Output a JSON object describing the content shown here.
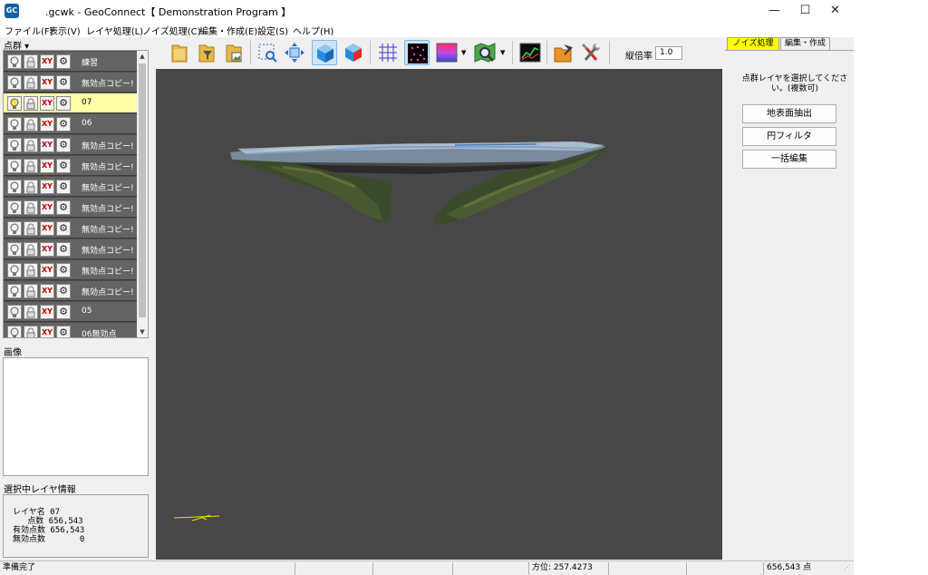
{
  "window": {
    "title": ".gcwk - GeoConnect【 Demonstration Program 】",
    "app_icon_text": "GC",
    "minimize": "—",
    "maximize": "☐",
    "close": "✕"
  },
  "menu": [
    "ファイル(F)",
    "表示(V)",
    "レイヤ処理(L)",
    "ノイズ処理(C)",
    "編集・作成(E)",
    "設定(S)",
    "ヘルプ(H)"
  ],
  "point_cloud_panel": {
    "label": "点群 ▾",
    "layers": [
      {
        "name": "練習",
        "selected": false
      },
      {
        "name": "無効点コピー!",
        "selected": false
      },
      {
        "name": "07",
        "selected": true
      },
      {
        "name": "06",
        "selected": false
      },
      {
        "name": "無効点コピー!",
        "selected": false
      },
      {
        "name": "無効点コピー!",
        "selected": false
      },
      {
        "name": "無効点コピー!",
        "selected": false
      },
      {
        "name": "無効点コピー!",
        "selected": false
      },
      {
        "name": "無効点コピー!",
        "selected": false
      },
      {
        "name": "無効点コピー!",
        "selected": false
      },
      {
        "name": "無効点コピー!",
        "selected": false
      },
      {
        "name": "無効点コピー!",
        "selected": false
      },
      {
        "name": "05",
        "selected": false
      },
      {
        "name": "06無効点",
        "selected": false
      }
    ]
  },
  "image_panel": {
    "label": "画像"
  },
  "layer_info": {
    "label": "選択中レイヤ情報",
    "lines": [
      "レイヤ名 07",
      "   点数 656,543",
      "有効点数 656,543",
      "無効点数       0"
    ]
  },
  "toolbar": {
    "zoom_label": "縦倍率",
    "zoom_value": "1.0"
  },
  "right_panel": {
    "tabs": [
      "ノイズ処理",
      "編集・作成"
    ],
    "message": "点群レイヤを選択してください。(複数可)",
    "buttons": [
      "地表面抽出",
      "円フィルタ",
      "一括編集"
    ]
  },
  "status": {
    "left": "準備完了",
    "azimuth": "方位: 257.4273",
    "point_count": "656,543 点"
  },
  "colors": {
    "viewport_bg": "#474747",
    "selected_layer": "#ffffa8",
    "active_tab": "#ffff00",
    "layer_row": "#646464"
  }
}
